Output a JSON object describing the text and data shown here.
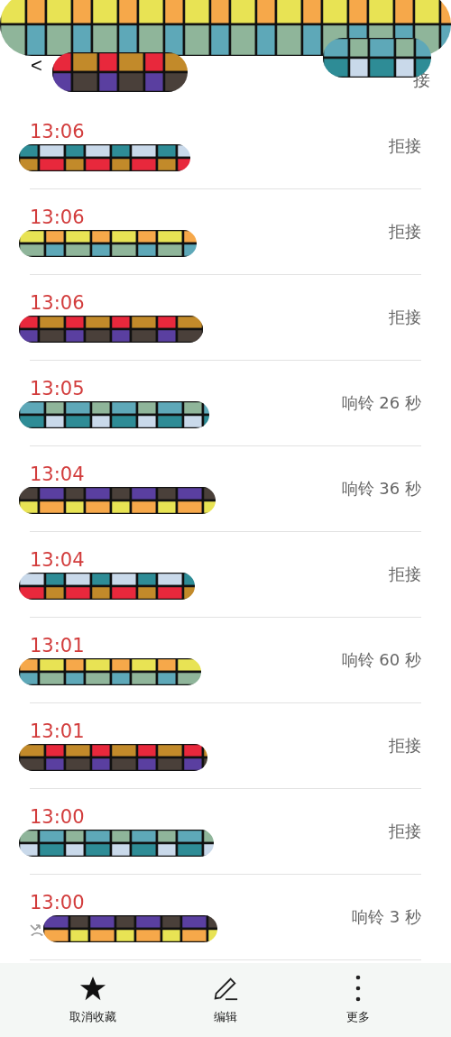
{
  "header": {
    "back": "<",
    "action_fragment": "接"
  },
  "calls": [
    {
      "time": "13:06",
      "status": "拒接",
      "missed": true
    },
    {
      "time": "13:06",
      "status": "拒接",
      "missed": true
    },
    {
      "time": "13:06",
      "status": "拒接",
      "missed": true
    },
    {
      "time": "13:05",
      "status": "响铃 26 秒",
      "missed": true
    },
    {
      "time": "13:04",
      "status": "响铃 36 秒",
      "missed": true
    },
    {
      "time": "13:04",
      "status": "拒接",
      "missed": true
    },
    {
      "time": "13:01",
      "status": "响铃 60 秒",
      "missed": true
    },
    {
      "time": "13:01",
      "status": "拒接",
      "missed": true
    },
    {
      "time": "13:00",
      "status": "拒接",
      "missed": true
    },
    {
      "time": "13:00",
      "status": "响铃 3 秒",
      "missed": true,
      "icon_visible": true
    }
  ],
  "bottom_bar": [
    {
      "kind": "star",
      "label": "取消收藏"
    },
    {
      "kind": "pencil",
      "label": "编辑"
    },
    {
      "kind": "more",
      "label": "更多"
    }
  ]
}
